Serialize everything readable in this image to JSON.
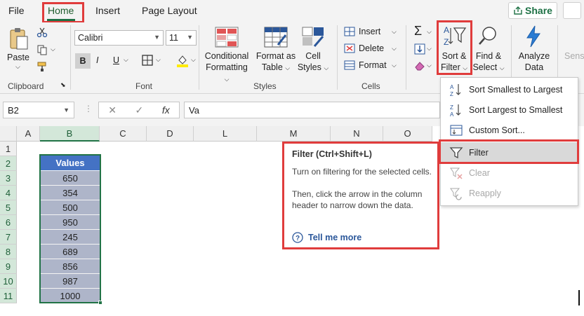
{
  "tabs": {
    "file": "File",
    "home": "Home",
    "insert": "Insert",
    "page_layout": "Page Layout",
    "share": "Share"
  },
  "ribbon": {
    "clipboard": {
      "label": "Clipboard",
      "paste": "Paste"
    },
    "font": {
      "label": "Font",
      "name": "Calibri",
      "size": "11",
      "bold": "B",
      "italic": "I",
      "underline": "U"
    },
    "styles": {
      "label": "Styles",
      "conditional_1": "Conditional",
      "conditional_2": "Formatting",
      "format_table_1": "Format as",
      "format_table_2": "Table",
      "cell_styles_1": "Cell",
      "cell_styles_2": "Styles"
    },
    "cells": {
      "label": "Cells",
      "insert": "Insert",
      "delete": "Delete",
      "format": "Format"
    },
    "editing": {
      "sort_1": "Sort &",
      "sort_2": "Filter",
      "find_1": "Find &",
      "find_2": "Select"
    },
    "analysis": {
      "analyze_1": "Analyze",
      "analyze_2": "Data",
      "sens": "Sens"
    }
  },
  "formula_bar": {
    "name_box": "B2",
    "cancel": "✕",
    "enter": "✓",
    "fx": "fx",
    "value": "Va"
  },
  "sheet": {
    "columns": [
      "A",
      "B",
      "C",
      "D",
      "L",
      "M",
      "N",
      "O"
    ],
    "rows": [
      "1",
      "2",
      "3",
      "4",
      "5",
      "6",
      "7",
      "8",
      "9",
      "10",
      "11"
    ],
    "header": "Values",
    "values": [
      "650",
      "354",
      "500",
      "950",
      "245",
      "689",
      "856",
      "987",
      "1000"
    ]
  },
  "tooltip": {
    "title": "Filter (Ctrl+Shift+L)",
    "line1": "Turn on filtering for the selected cells.",
    "line2": "Then, click the arrow in the column header to narrow down the data.",
    "link": "Tell me more"
  },
  "menu": {
    "items": [
      {
        "label": "Sort Smallest to Largest",
        "icon": "sort-ascending-icon"
      },
      {
        "label": "Sort Largest to Smallest",
        "icon": "sort-descending-icon"
      },
      {
        "label": "Custom Sort...",
        "icon": "custom-sort-icon"
      },
      {
        "label": "Filter",
        "icon": "filter-icon"
      },
      {
        "label": "Clear",
        "icon": "clear-filter-icon"
      },
      {
        "label": "Reapply",
        "icon": "reapply-icon"
      }
    ]
  },
  "colors": {
    "accent": "#217346",
    "highlight_box": "#e03c3c",
    "header_fill": "#4472c4",
    "value_fill": "#aeb5c9",
    "link": "#2b579a"
  }
}
